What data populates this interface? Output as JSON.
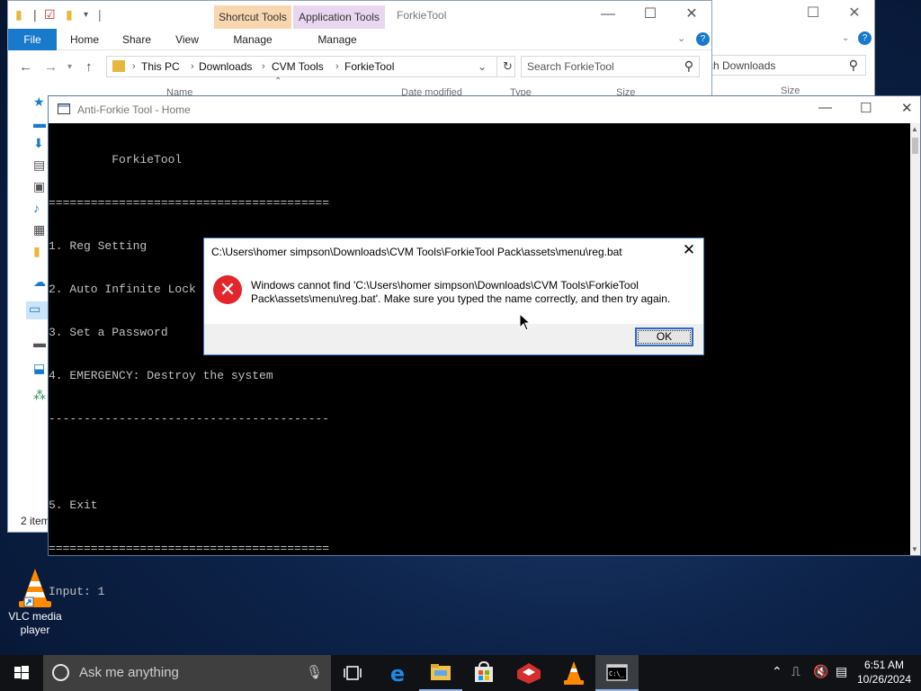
{
  "explorer": {
    "ctx_tab_shortcut": "Shortcut Tools",
    "ctx_tab_application": "Application Tools",
    "window_title": "ForkieTool",
    "ribbon_tabs": [
      "File",
      "Home",
      "Share",
      "View",
      "Manage",
      "Manage"
    ],
    "breadcrumb": [
      "This PC",
      "Downloads",
      "CVM Tools",
      "ForkieTool"
    ],
    "search_placeholder": "Search ForkieTool",
    "column_name": "Name",
    "column_date": "Date modified",
    "column_type": "Type",
    "column_size": "Size",
    "status_items": "2 item"
  },
  "explorer_back": {
    "search_placeholder": "ch Downloads",
    "column_size": "Size"
  },
  "console": {
    "title": "Anti-Forkie Tool - Home",
    "lines": [
      "         ForkieTool",
      "========================================",
      "1. Reg Setting",
      "2. Auto Infinite Lock",
      "3. Set a Password",
      "4. EMERGENCY: Destroy the system",
      "----------------------------------------",
      "",
      "5. Exit",
      "========================================",
      "Input: 1"
    ]
  },
  "dialog": {
    "title": "C:\\Users\\homer simpson\\Downloads\\CVM Tools\\ForkieTool Pack\\assets\\menu\\reg.bat",
    "message": "Windows cannot find 'C:\\Users\\homer simpson\\Downloads\\CVM Tools\\ForkieTool Pack\\assets\\menu\\reg.bat'. Make sure you typed the name correctly, and then try again.",
    "ok_label": "OK"
  },
  "desktop": {
    "vlc_label": "VLC media player"
  },
  "taskbar": {
    "search_placeholder": "Ask me anything",
    "time": "6:51 AM",
    "date": "10/26/2024"
  },
  "colors": {
    "accent": "#1979ca",
    "error_red": "#e2262b",
    "console_text": "#c0c0c0"
  }
}
